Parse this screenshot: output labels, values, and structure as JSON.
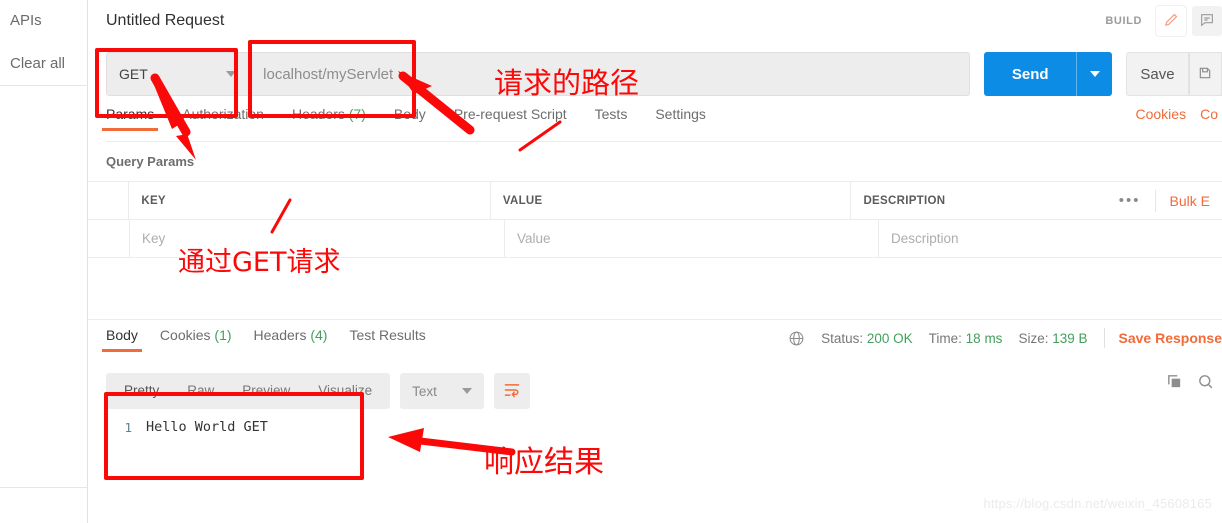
{
  "sidebar": {
    "items": [
      {
        "label": "APIs",
        "name": "sidebar-item-apis"
      },
      {
        "label": "Clear all",
        "name": "sidebar-item-clear-all"
      }
    ]
  },
  "header": {
    "title": "Untitled Request",
    "build_label": "BUILD",
    "edit_icon": "pencil-icon",
    "comment_icon": "comment-icon"
  },
  "url_bar": {
    "method": "GET",
    "url_value": "localhost/myServlet",
    "send_label": "Send",
    "send_caret": "chevron-down-icon",
    "save_label": "Save",
    "save_extra_icon": "save-as-icon"
  },
  "request_tabs": {
    "items": [
      {
        "label": "Params",
        "count": "",
        "active": true
      },
      {
        "label": "Authorization",
        "count": "",
        "active": false
      },
      {
        "label": "Headers",
        "count": "(7)",
        "active": false
      },
      {
        "label": "Body",
        "count": "",
        "active": false
      },
      {
        "label": "Pre-request Script",
        "count": "",
        "active": false
      },
      {
        "label": "Tests",
        "count": "",
        "active": false
      },
      {
        "label": "Settings",
        "count": "",
        "active": false
      }
    ],
    "right_links": [
      {
        "label": "Cookies"
      },
      {
        "label": "Co"
      }
    ]
  },
  "query_params": {
    "section_label": "Query Params",
    "columns": [
      "KEY",
      "VALUE",
      "DESCRIPTION"
    ],
    "rows": [
      {
        "key": "Key",
        "value": "Value",
        "description": "Description"
      }
    ],
    "more_actions_icon": "ellipsis-icon",
    "bulk_edit_label": "Bulk E"
  },
  "response": {
    "tabs": [
      {
        "label": "Body",
        "count": "",
        "active": true
      },
      {
        "label": "Cookies",
        "count": "(1)",
        "active": false
      },
      {
        "label": "Headers",
        "count": "(4)",
        "active": false
      },
      {
        "label": "Test Results",
        "count": "",
        "active": false
      }
    ],
    "globe_icon": "globe-icon",
    "status_label": "Status:",
    "status_value": "200 OK",
    "time_label": "Time:",
    "time_value": "18 ms",
    "size_label": "Size:",
    "size_value": "139 B",
    "save_response_label": "Save Response",
    "view_tabs": [
      {
        "label": "Pretty",
        "active": true
      },
      {
        "label": "Raw",
        "active": false
      },
      {
        "label": "Preview",
        "active": false
      },
      {
        "label": "Visualize",
        "active": false
      }
    ],
    "format_select": "Text",
    "wrap_icon": "word-wrap-icon",
    "copy_icon": "copy-icon",
    "search_icon": "search-icon",
    "body_lines": [
      {
        "number": "1",
        "text": "Hello World GET"
      }
    ]
  },
  "annotations": [
    {
      "text": "请求的路径",
      "name": "annotation-request-path"
    },
    {
      "text": "通过GET请求",
      "name": "annotation-get-request"
    },
    {
      "text": "响应结果",
      "name": "annotation-response-result"
    }
  ],
  "watermark": "https://blog.csdn.net/weixin_45608165",
  "colors": {
    "accent_orange": "#f26b3a",
    "send_blue": "#0d8ce6",
    "success_green": "#42a05b",
    "annotation_red": "#fb0808"
  }
}
